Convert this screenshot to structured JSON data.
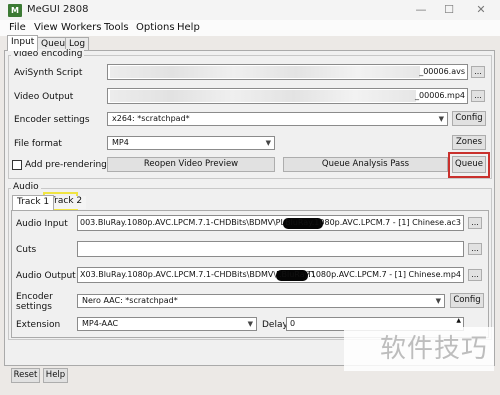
{
  "window": {
    "title": "MeGUI 2808",
    "app_icon_text": "M",
    "minimize_glyph": "—",
    "maximize_glyph": "☐",
    "close_glyph": "✕"
  },
  "menu": [
    "File",
    "View",
    "Workers",
    "Tools",
    "Options",
    "Help"
  ],
  "tabs": [
    "Input",
    "Queue",
    "Log"
  ],
  "video": {
    "group_label": "Video encoding",
    "avisynth_label": "AviSynth Script",
    "avisynth_value_tail": "_00006.avs",
    "output_label": "Video Output",
    "output_value_tail": "_00006.mp4",
    "encoder_label": "Encoder settings",
    "encoder_value": "x264: *scratchpad*",
    "config_label": "Config",
    "format_label": "File format",
    "format_value": "MP4",
    "zones_label": "Zones",
    "prerender_label": "Add pre-rendering job",
    "reopen_label": "Reopen Video Preview",
    "analysis_label": "Queue Analysis Pass",
    "queue_label": "Queue",
    "dots": "..."
  },
  "audio": {
    "group_label": "Audio",
    "tracks": [
      "Track 1",
      "Track 2"
    ],
    "input_label": "Audio Input",
    "input_value_start": "003.BluRay.1080p.AVC.LPCM.7.1-CHDBits\\BDMV\\PLAYLIST\\",
    "input_value_end": ".BluRay.1080p.AVC.LPCM.7 - [1] Chinese.ac3",
    "cuts_label": "Cuts",
    "output_label": "Audio Output",
    "output_value_start": "X03.BluRay.1080p.AVC.LPCM.7.1-CHDBits\\BDMV\\PLAYLIST\\",
    "output_value_end": ".BluRay.1080p.AVC.LPCM.7 - [1] Chinese.mp4",
    "encoder_label_1": "Encoder",
    "encoder_label_2": "settings",
    "encoder_value": "Nero AAC: *scratchpad*",
    "config_label": "Config",
    "extension_label": "Extension",
    "extension_value": "MP4-AAC",
    "delay_label": "Delay",
    "delay_value": "0"
  },
  "bottom": {
    "reset_label": "Reset",
    "help_label": "Help"
  },
  "watermark": "软件技巧"
}
